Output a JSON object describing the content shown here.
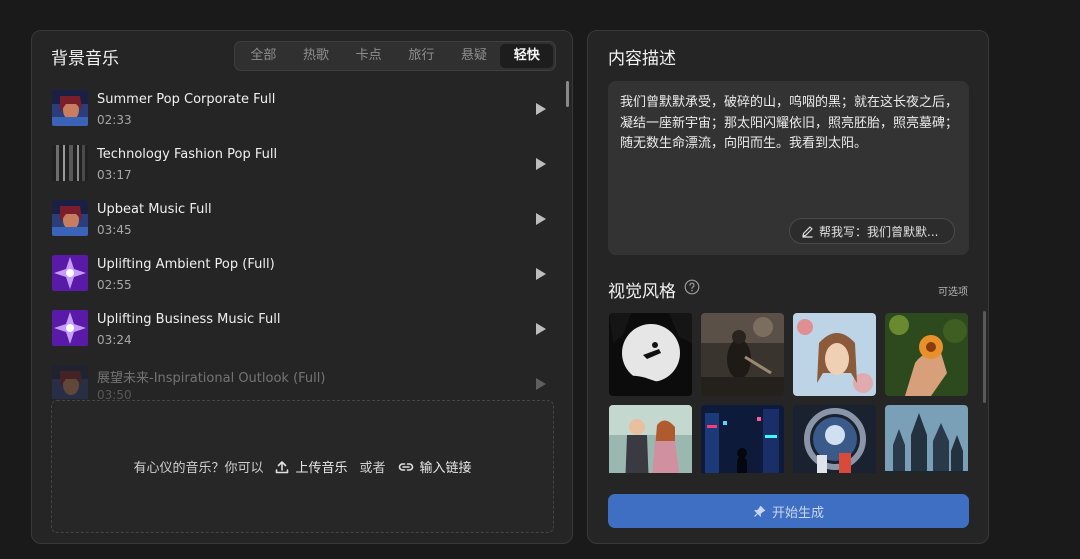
{
  "music": {
    "title": "背景音乐",
    "tabs": [
      "全部",
      "热歌",
      "卡点",
      "旅行",
      "悬疑",
      "轻快"
    ],
    "tracks": [
      {
        "name": "Summer Pop Corporate Full",
        "duration": "02:33"
      },
      {
        "name": "Technology Fashion Pop Full",
        "duration": "03:17"
      },
      {
        "name": "Upbeat Music Full",
        "duration": "03:45"
      },
      {
        "name": "Uplifting Ambient Pop (Full)",
        "duration": "02:55"
      },
      {
        "name": "Uplifting Business Music Full",
        "duration": "03:24"
      },
      {
        "name": "展望未来-Inspirational Outlook (Full)",
        "duration": "03:50"
      }
    ],
    "upload": {
      "prompt": "有心仪的音乐？你可以",
      "upload_label": "上传音乐",
      "or_label": "或者",
      "link_label": "输入链接"
    }
  },
  "description": {
    "title": "内容描述",
    "text": "我们曾默默承受，破碎的山，呜咽的黑；就在这长夜之后，凝结一座新宇宙；那太阳闪耀依旧，照亮胚胎，照亮墓碑；随无数生命漂流，向阳而生。我看到太阳。",
    "help_label": "帮我写：我们曾默默..."
  },
  "style": {
    "title": "视觉风格",
    "optional": "可选项"
  },
  "generate_label": "开始生成"
}
